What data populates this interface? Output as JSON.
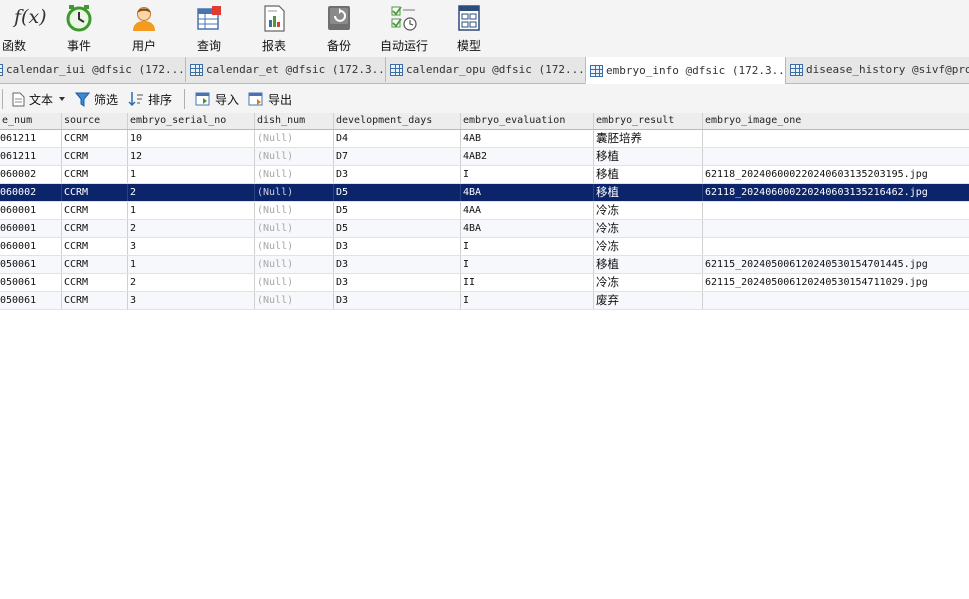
{
  "toolbar": {
    "items": [
      {
        "label": "函数",
        "icon": "function-icon"
      },
      {
        "label": "事件",
        "icon": "clock-icon"
      },
      {
        "label": "用户",
        "icon": "user-icon"
      },
      {
        "label": "查询",
        "icon": "query-icon"
      },
      {
        "label": "报表",
        "icon": "report-icon"
      },
      {
        "label": "备份",
        "icon": "backup-icon"
      },
      {
        "label": "自动运行",
        "icon": "automation-icon"
      },
      {
        "label": "模型",
        "icon": "model-icon"
      }
    ],
    "fx_glyph": "f(x)"
  },
  "tabs": [
    {
      "label": "calendar_iui @dfsic (172...."
    },
    {
      "label": "calendar_et @dfsic (172.3..."
    },
    {
      "label": "calendar_opu @dfsic (172...."
    },
    {
      "label": "embryo_info @dfsic (172.3..."
    },
    {
      "label": "disease_history @sivf@pro..."
    }
  ],
  "subbar": {
    "text_label": "文本",
    "filter_label": "筛选",
    "sort_label": "排序",
    "import_label": "导入",
    "export_label": "导出"
  },
  "table": {
    "columns": [
      "e_num",
      "source",
      "embryo_serial_no",
      "dish_num",
      "development_days",
      "embryo_evaluation",
      "embryo_result",
      "embryo_image_one"
    ],
    "rows": [
      [
        "061211",
        "CCRM",
        "10",
        "(Null)",
        "D4",
        "4AB",
        "囊胚培养",
        ""
      ],
      [
        "061211",
        "CCRM",
        "12",
        "(Null)",
        "D7",
        "4AB2",
        "移植",
        ""
      ],
      [
        "060002",
        "CCRM",
        "1",
        "(Null)",
        "D3",
        "I",
        "移植",
        "62118_20240600022024060313520319​5.jpg"
      ],
      [
        "060002",
        "CCRM",
        "2",
        "(Null)",
        "D5",
        "4BA",
        "移植",
        "62118_2024060002202406031352164​62.jpg"
      ],
      [
        "060001",
        "CCRM",
        "1",
        "(Null)",
        "D5",
        "4AA",
        "冷冻",
        ""
      ],
      [
        "060001",
        "CCRM",
        "2",
        "(Null)",
        "D5",
        "4BA",
        "冷冻",
        ""
      ],
      [
        "060001",
        "CCRM",
        "3",
        "(Null)",
        "D3",
        "I",
        "冷冻",
        ""
      ],
      [
        "050061",
        "CCRM",
        "1",
        "(Null)",
        "D3",
        "I",
        "移植",
        "62115_20240500612024053015470144​5.jpg"
      ],
      [
        "050061",
        "CCRM",
        "2",
        "(Null)",
        "D3",
        "II",
        "冷冻",
        "62115_20240500612024053015471102​9.jpg"
      ],
      [
        "050061",
        "CCRM",
        "3",
        "(Null)",
        "D3",
        "I",
        "废弃",
        ""
      ]
    ],
    "selected_row_index": 3
  },
  "colors": {
    "selection": "#0c246a",
    "accent_blue": "#3a6ea5"
  }
}
